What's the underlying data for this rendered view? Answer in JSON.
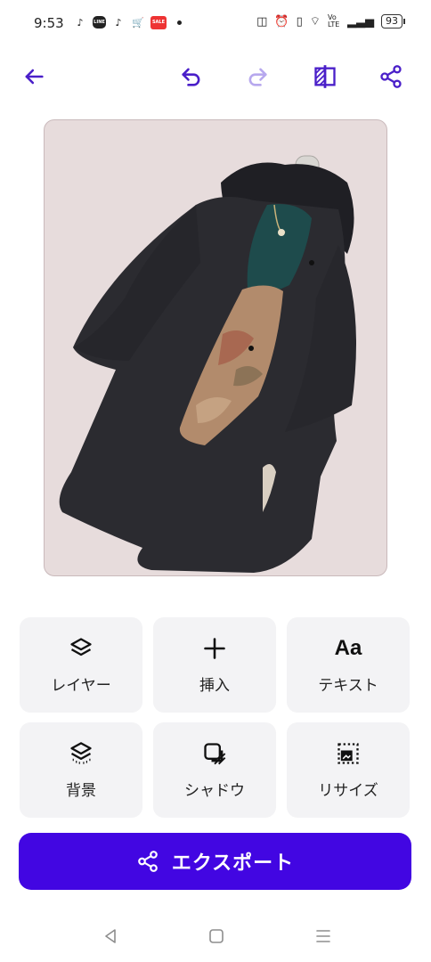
{
  "status_bar": {
    "time": "9:53",
    "notification_icons": [
      "tiktok-icon",
      "line-icon",
      "tiktok-icon",
      "cart-icon",
      "app-icon"
    ],
    "line_text": "LINE",
    "red_app_text": "SALE",
    "network": "Vo LTE",
    "battery": "93"
  },
  "toolbar": {
    "back": "back-arrow-icon",
    "undo": "undo-icon",
    "redo": "redo-icon",
    "compare": "compare-icon",
    "share": "share-icon"
  },
  "tools": [
    {
      "label": "レイヤー",
      "icon": "layers-icon"
    },
    {
      "label": "挿入",
      "icon": "plus-icon"
    },
    {
      "label": "テキスト",
      "icon": "text-icon",
      "icon_text": "Aa"
    },
    {
      "label": "背景",
      "icon": "background-icon"
    },
    {
      "label": "シャドウ",
      "icon": "shadow-icon"
    },
    {
      "label": "リサイズ",
      "icon": "resize-icon"
    }
  ],
  "export": {
    "label": "エクスポート"
  },
  "colors": {
    "accent": "#4206e2",
    "toolbar_icon": "#4a1fc9",
    "redo_disabled": "#b7a8ee",
    "canvas_bg": "#e7dcdc"
  }
}
